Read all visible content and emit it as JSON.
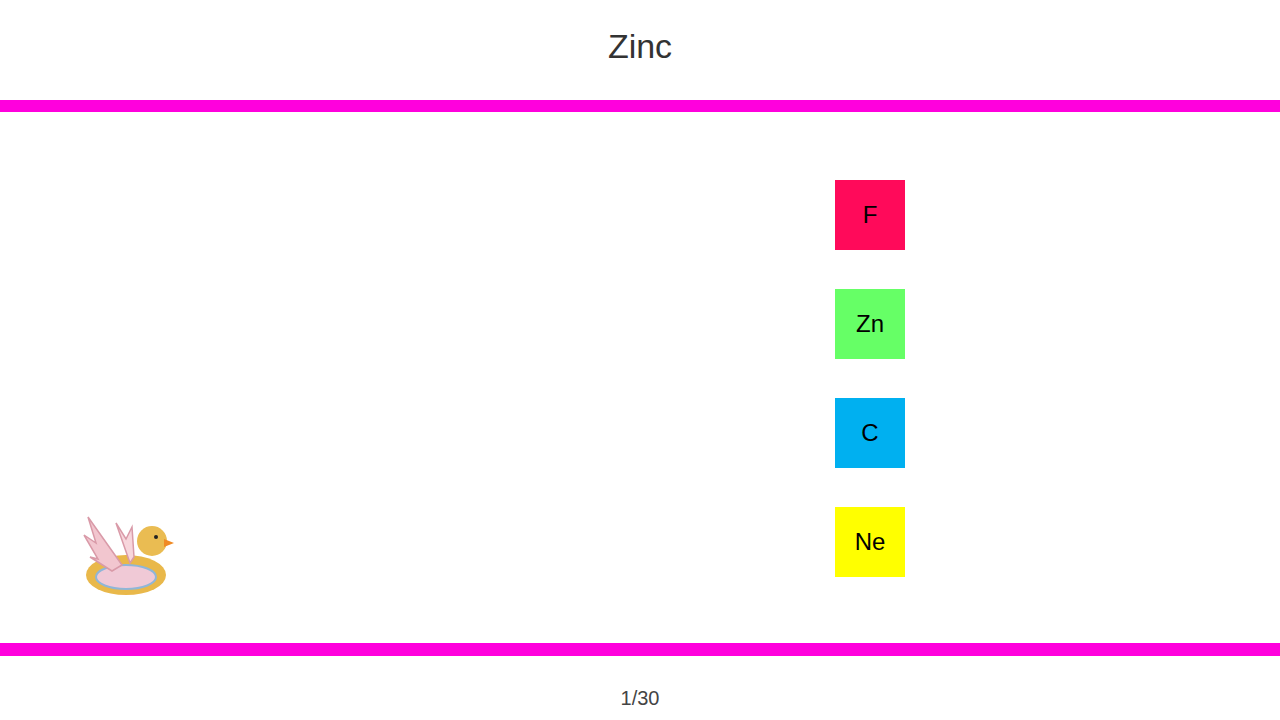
{
  "question": {
    "title": "Zinc"
  },
  "options": [
    {
      "label": "F",
      "color": "#ff0a5a"
    },
    {
      "label": "Zn",
      "color": "#66ff66"
    },
    {
      "label": "C",
      "color": "#00b0f0"
    },
    {
      "label": "Ne",
      "color": "#ffff00"
    }
  ],
  "status_bar": {
    "progress": "1/30"
  }
}
